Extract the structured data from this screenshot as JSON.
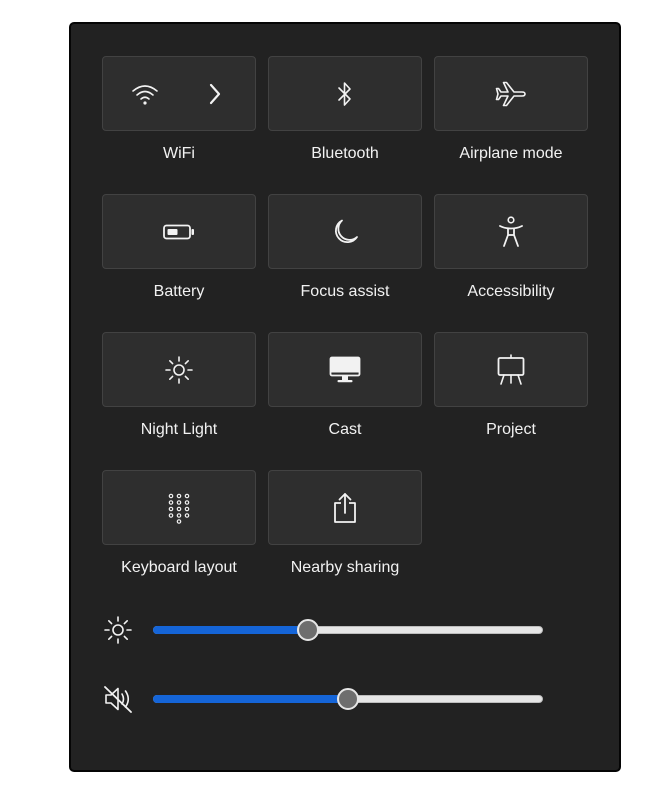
{
  "tiles": {
    "wifi": {
      "label": "WiFi",
      "icon": "wifi-icon",
      "secondary_icon": "chevron-right-icon"
    },
    "bluetooth": {
      "label": "Bluetooth",
      "icon": "bluetooth-icon"
    },
    "airplane": {
      "label": "Airplane mode",
      "icon": "airplane-icon"
    },
    "battery": {
      "label": "Battery",
      "icon": "battery-icon"
    },
    "focus": {
      "label": "Focus assist",
      "icon": "moon-icon"
    },
    "accessibility": {
      "label": "Accessibility",
      "icon": "accessibility-icon"
    },
    "nightlight": {
      "label": "Night Light",
      "icon": "sun-icon"
    },
    "cast": {
      "label": "Cast",
      "icon": "monitor-icon"
    },
    "project": {
      "label": "Project",
      "icon": "projector-icon"
    },
    "keyboard": {
      "label": "Keyboard layout",
      "icon": "keypad-icon"
    },
    "sharing": {
      "label": "Nearby sharing",
      "icon": "share-icon"
    }
  },
  "sliders": {
    "brightness": {
      "icon": "brightness-icon",
      "value": 0.397
    },
    "volume": {
      "icon": "volume-muted-icon",
      "value": 0.5
    }
  },
  "colors": {
    "panel": "#222222",
    "tile": "#2e2e2e",
    "accent": "#1565d8",
    "text": "#f2f2f2"
  }
}
